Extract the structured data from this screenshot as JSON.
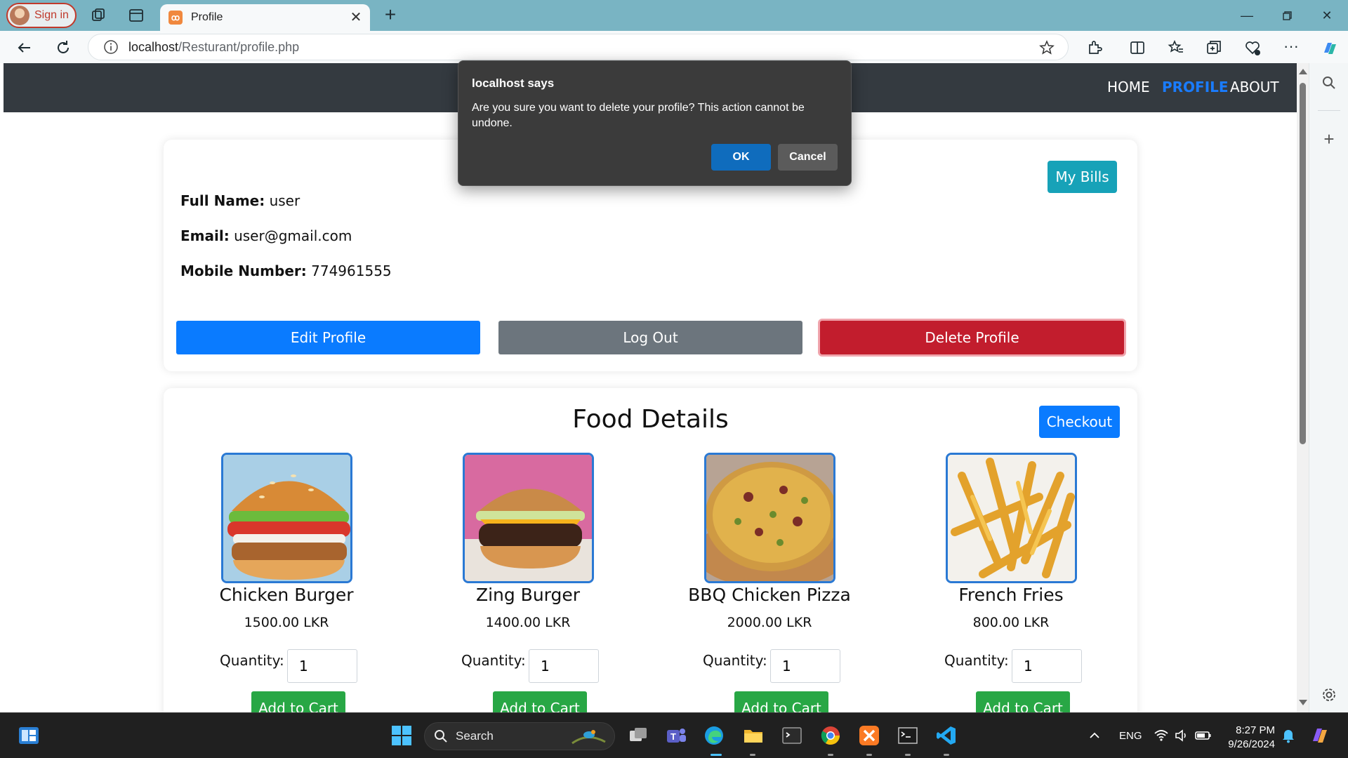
{
  "browser": {
    "signin_label": "Sign in",
    "tab_title": "Profile",
    "tab_favicon": "XAMPP",
    "url_host": "localhost",
    "url_path": "/Resturant/profile.php"
  },
  "site_nav": {
    "home": "HOME",
    "profile": "PROFILE",
    "about": "ABOUT"
  },
  "profile": {
    "my_bills_label": "My Bills",
    "full_name_label": "Full Name:",
    "full_name_value": "user",
    "email_label": "Email:",
    "email_value": "user@gmail.com",
    "mobile_label": "Mobile Number:",
    "mobile_value": "774961555",
    "edit_label": "Edit Profile",
    "logout_label": "Log Out",
    "delete_label": "Delete Profile"
  },
  "food": {
    "title": "Food Details",
    "checkout_label": "Checkout",
    "quantity_label": "Quantity:",
    "add_label": "Add to Cart",
    "items": [
      {
        "name": "Chicken Burger",
        "price": "1500.00 LKR",
        "qty": "1"
      },
      {
        "name": "Zing Burger",
        "price": "1400.00 LKR",
        "qty": "1"
      },
      {
        "name": "BBQ Chicken Pizza",
        "price": "2000.00 LKR",
        "qty": "1"
      },
      {
        "name": "French Fries",
        "price": "800.00 LKR",
        "qty": "1"
      }
    ]
  },
  "dialog": {
    "title": "localhost says",
    "message": "Are you sure you want to delete your profile? This action cannot be undone.",
    "ok_label": "OK",
    "cancel_label": "Cancel"
  },
  "taskbar": {
    "search_label": "Search",
    "language": "ENG",
    "time": "8:27 PM",
    "date": "9/26/2024"
  },
  "colors": {
    "navbar": "#343a40",
    "active_link": "#1a7cff",
    "primary": "#0a7bff",
    "secondary": "#6c757d",
    "danger": "#c21d2d",
    "info": "#17a2b8",
    "success": "#28a745"
  }
}
